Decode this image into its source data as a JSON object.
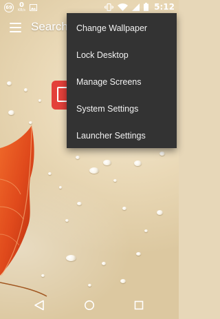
{
  "status_bar": {
    "notification_count": "69",
    "speed_value": "0",
    "speed_unit": "KB/s",
    "time": "5:12",
    "icons": [
      "notification-badge-icon",
      "image-icon",
      "vibrate-icon",
      "wifi-icon",
      "signal-icon",
      "battery-icon"
    ]
  },
  "top_bar": {
    "menu_icon": "hamburger-menu-icon",
    "search_label": "Search"
  },
  "popup_menu": {
    "items": [
      {
        "label": "Change Wallpaper"
      },
      {
        "label": "Lock Desktop"
      },
      {
        "label": "Manage Screens"
      },
      {
        "label": "System Settings"
      },
      {
        "label": "Launcher Settings"
      }
    ]
  },
  "nav_bar": {
    "buttons": [
      "back-icon",
      "home-icon",
      "recents-icon"
    ]
  },
  "colors": {
    "menu_background": "#333333",
    "menu_text": "#f2f2f2",
    "app_icon": "#e3403a",
    "leaf": "#e2471b"
  }
}
